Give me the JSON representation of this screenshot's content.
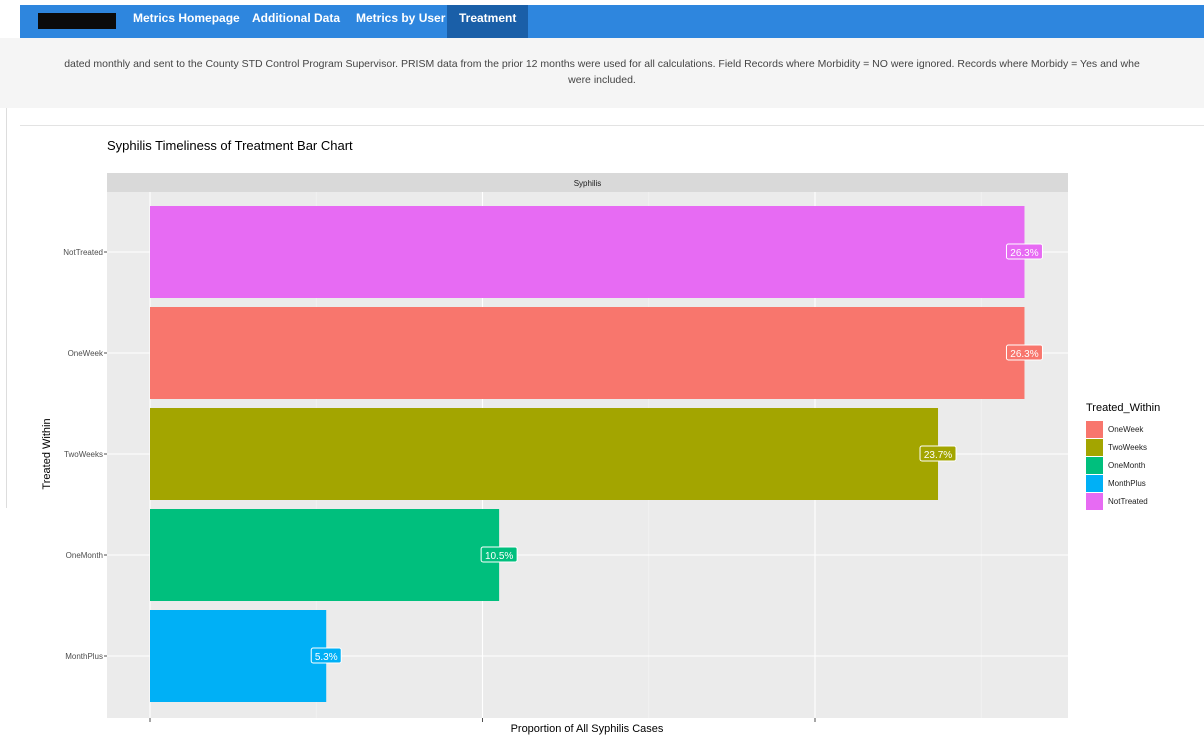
{
  "nav": {
    "brand_redacted": true,
    "tabs": [
      {
        "label": "Metrics Homepage",
        "active": false
      },
      {
        "label": "Additional Data",
        "active": false
      },
      {
        "label": "Metrics by User",
        "active": false
      },
      {
        "label": "Treatment",
        "active": true
      }
    ],
    "color": "#2e86de",
    "active_color": "#1a5fa8"
  },
  "description": {
    "line1": "dated monthly and sent to the County STD Control Program Supervisor. PRISM data from the prior 12 months were used for all calculations. Field Records where Morbidity = NO were ignored. Records where Morbidy = Yes and whe",
    "line2": "were included."
  },
  "chart_data": {
    "type": "bar",
    "orientation": "horizontal",
    "title": "Syphilis Timeliness of Treatment Bar Chart",
    "facet_label": "Syphilis",
    "xlabel": "Proportion of All Syphilis Cases",
    "ylabel": "Treated Within",
    "categories": [
      "NotTreated",
      "OneWeek",
      "TwoWeeks",
      "OneMonth",
      "MonthPlus"
    ],
    "values": [
      26.3,
      26.3,
      23.7,
      10.5,
      5.3
    ],
    "labels": [
      "26.3%",
      "26.3%",
      "23.7%",
      "10.5%",
      "5.3%"
    ],
    "colors": [
      "#e76bf3",
      "#f8766d",
      "#a3a500",
      "#00bf7d",
      "#00b0f6"
    ],
    "xlim": [
      0,
      27.5
    ],
    "x_ticks": [
      0,
      10,
      20
    ],
    "x_tick_labels_shown": false,
    "grid": true,
    "legend": {
      "title": "Treated_Within",
      "position": "right",
      "items": [
        {
          "label": "OneWeek",
          "color": "#f8766d"
        },
        {
          "label": "TwoWeeks",
          "color": "#a3a500"
        },
        {
          "label": "OneMonth",
          "color": "#00bf7d"
        },
        {
          "label": "MonthPlus",
          "color": "#00b0f6"
        },
        {
          "label": "NotTreated",
          "color": "#e76bf3"
        }
      ]
    }
  }
}
